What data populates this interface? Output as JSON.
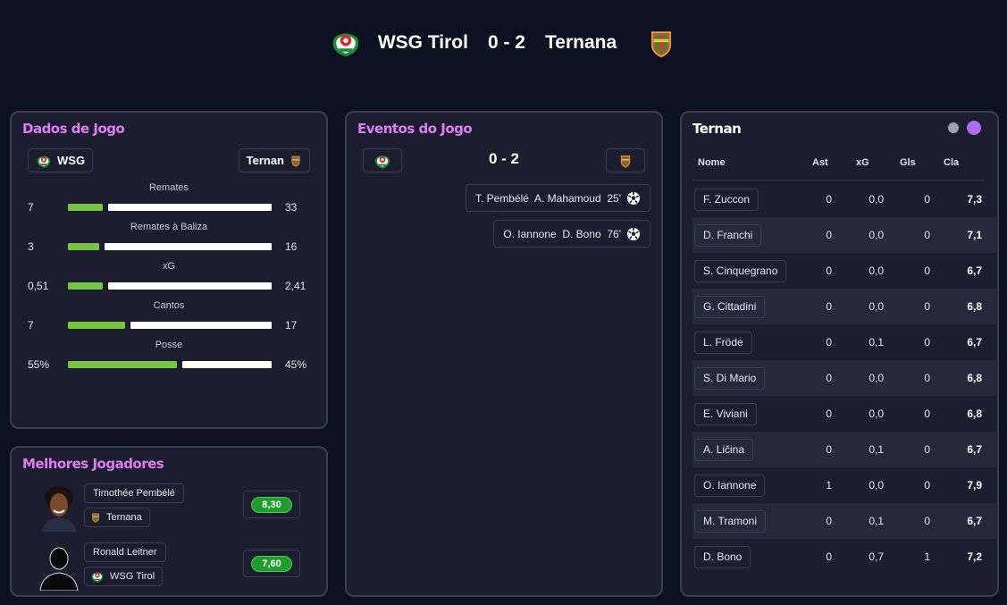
{
  "match": {
    "home_team": "WSG Tirol",
    "away_team": "Ternana",
    "score": "0 - 2",
    "home_crest_icon": "wsg-tirol-crest-icon",
    "away_crest_icon": "ternana-crest-icon"
  },
  "stats_panel": {
    "title": "Dados de Jogo",
    "home_chip": "WSG",
    "away_chip": "Ternan",
    "stats": [
      {
        "label": "Remates",
        "home": "7",
        "away": "33",
        "home_share": 0.175
      },
      {
        "label": "Remates à Baliza",
        "home": "3",
        "away": "16",
        "home_share": 0.158
      },
      {
        "label": "xG",
        "home": "0,51",
        "away": "2,41",
        "home_share": 0.175
      },
      {
        "label": "Cantos",
        "home": "7",
        "away": "17",
        "home_share": 0.29
      },
      {
        "label": "Posse",
        "home": "55%",
        "away": "45%",
        "home_share": 0.55
      }
    ],
    "colors": {
      "home_bar": "#76c442",
      "away_bar": "#ffffff"
    }
  },
  "best_players": {
    "title": "Melhores Jogadores",
    "players": [
      {
        "name": "Timothée Pembélé",
        "team": "Ternana",
        "rating": "8,30",
        "team_icon": "ternana-crest-icon",
        "avatar_icon": "player-photo-icon"
      },
      {
        "name": "Ronald Leitner",
        "team": "WSG Tirol",
        "rating": "7,60",
        "team_icon": "wsg-tirol-crest-icon",
        "avatar_icon": "player-silhouette-icon"
      }
    ],
    "rating_color": "#1f9d2c"
  },
  "events_panel": {
    "title": "Eventos do Jogo",
    "score": "0 - 2",
    "events": [
      {
        "text": "T. Pembélé  A. Mahamoud  25'",
        "icon": "soccer-ball-icon"
      },
      {
        "text": "O. Iannone  D. Bono  76'",
        "icon": "soccer-ball-icon"
      }
    ]
  },
  "lineup_panel": {
    "title": "Ternan",
    "columns": [
      "Nome",
      "Ast",
      "xG",
      "Gls",
      "Cla"
    ],
    "rows": [
      {
        "name": "F. Zuccon",
        "ast": "0",
        "xg": "0,0",
        "gls": "0",
        "cla": "7,3"
      },
      {
        "name": "D. Franchi",
        "ast": "0",
        "xg": "0,0",
        "gls": "0",
        "cla": "7,1"
      },
      {
        "name": "S. Cinquegrano",
        "ast": "0",
        "xg": "0,0",
        "gls": "0",
        "cla": "6,7"
      },
      {
        "name": "G. Cittadini",
        "ast": "0",
        "xg": "0,0",
        "gls": "0",
        "cla": "6,8"
      },
      {
        "name": "L. Fröde",
        "ast": "0",
        "xg": "0,1",
        "gls": "0",
        "cla": "6,7"
      },
      {
        "name": "S. Di Mario",
        "ast": "0",
        "xg": "0,0",
        "gls": "0",
        "cla": "6,8"
      },
      {
        "name": "E. Viviani",
        "ast": "0",
        "xg": "0,0",
        "gls": "0",
        "cla": "6,8"
      },
      {
        "name": "A. Ličina",
        "ast": "0",
        "xg": "0,1",
        "gls": "0",
        "cla": "6,7"
      },
      {
        "name": "O. Iannone",
        "ast": "1",
        "xg": "0,0",
        "gls": "0",
        "cla": "7,9"
      },
      {
        "name": "M. Tramoni",
        "ast": "0",
        "xg": "0,1",
        "gls": "0",
        "cla": "6,7"
      },
      {
        "name": "D. Bono",
        "ast": "0",
        "xg": "0,7",
        "gls": "1",
        "cla": "7,2"
      }
    ],
    "toggle_colors": {
      "inactive": "#9aa5ad",
      "active": "#b06cf0"
    }
  }
}
